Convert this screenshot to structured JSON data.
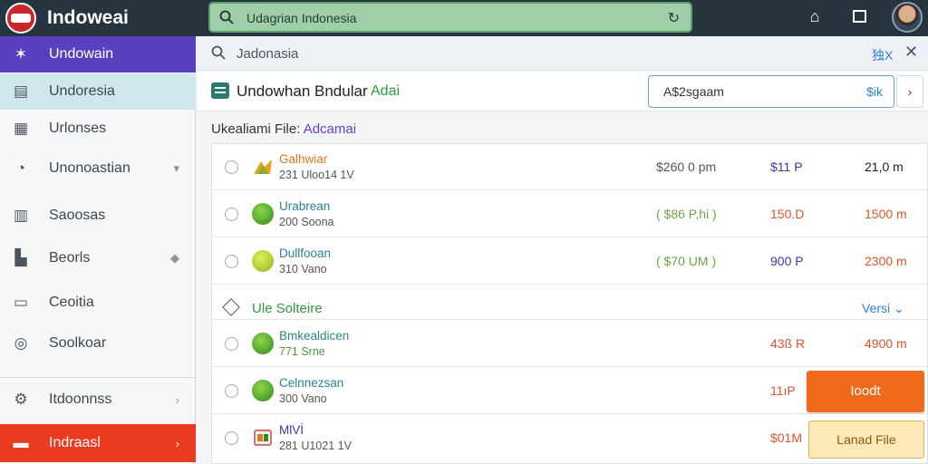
{
  "app": {
    "title": "Indoweai"
  },
  "search": {
    "value": "Udagrian Indonesia"
  },
  "sidebar": {
    "items": [
      {
        "label": "Undowain",
        "icon": "star-icon",
        "state": "active-purple"
      },
      {
        "label": "Undoresia",
        "icon": "grid-icon",
        "state": "active-teal"
      },
      {
        "label": "Urlonses",
        "icon": "calculator-icon",
        "state": ""
      },
      {
        "label": "Unonoastian",
        "icon": "compass-icon",
        "state": "",
        "chevron": "▾"
      },
      {
        "label": "Saoosas",
        "icon": "briefcase-icon",
        "state": ""
      },
      {
        "label": "Beorls",
        "icon": "building-icon",
        "state": "",
        "chevron": "◆"
      },
      {
        "label": "Ceoitia",
        "icon": "window-icon",
        "state": ""
      },
      {
        "label": "Soolkoar",
        "icon": "target-icon",
        "state": ""
      },
      {
        "label": "Itdoonnss",
        "icon": "gear-icon",
        "state": "",
        "chevron": "›"
      },
      {
        "label": "Indraasl",
        "icon": "wallet-icon",
        "state": "active-red",
        "chevron": "›"
      }
    ]
  },
  "crumb": {
    "text": "Jadonasia",
    "right": "独X"
  },
  "header": {
    "title": "Undowhan Bndular",
    "accent": "Adai",
    "amount": "A$2sgaam",
    "amount_unit": "$ik",
    "next": "›"
  },
  "section": {
    "label": "Ukealiami File:",
    "accent": "Adcamai"
  },
  "rows": [
    {
      "name": "Galhwiar",
      "name_color": "#e0761e",
      "sub": "231 Uloo14 1V",
      "c1": "$260 0 pm",
      "c1_color": "#555555",
      "c2": "$11 P",
      "c2_color": "#3a3aa8",
      "c3": "21,0 m",
      "c3_color": "#222222",
      "thumb": "thumb-mixed"
    },
    {
      "name": "Urabrean",
      "name_color": "#2a7f9c",
      "sub": "200 Soona",
      "c1": "( $86 P,hi )",
      "c1_color": "#6aa640",
      "c2": "150.D",
      "c2_color": "#e0522a",
      "c3": "1500 m",
      "c3_color": "#e0522a",
      "thumb": "thumb-green"
    },
    {
      "name": "Dullfooan",
      "name_color": "#2a7f9c",
      "sub": "310 Vano",
      "c1": "( $70 UM )",
      "c1_color": "#6aa640",
      "c2": "900 P",
      "c2_color": "#3a3aa8",
      "c3": "2300 m",
      "c3_color": "#e0522a",
      "thumb": "thumb-lime"
    },
    {
      "group": true,
      "label": "Ule Solteire",
      "right": "Versi ⌄"
    },
    {
      "name": "Bmkealdicen",
      "name_color": "#2a8a86",
      "sub": "771 Srne",
      "c1": "",
      "c2": "43ß R",
      "c2_color": "#e0522a",
      "c3": "4900 m",
      "c3_color": "#e0522a",
      "thumb": "thumb-green",
      "sub_color": "#4c9b3a"
    },
    {
      "name": "Celnnezsan",
      "name_color": "#2a7f9c",
      "sub": "300 Vano",
      "c1": "",
      "c2": "11ıP",
      "c2_color": "#e0522a",
      "c3": "",
      "thumb": "thumb-green"
    },
    {
      "name": "MlVİ",
      "name_color": "#3a3aa8",
      "sub": "281 U1021 1V",
      "c1": "",
      "c2": "$01M",
      "c2_color": "#e0522a",
      "c3": "",
      "thumb": "thumb-mixed"
    }
  ],
  "buttons": {
    "primary": "Ioodt",
    "secondary": "Lanad File"
  },
  "colors": {
    "topbar": "#26343f",
    "active_purple": "#5a3fc0",
    "active_red": "#ea3b22",
    "search_bg": "#9fcfa9",
    "orange": "#f06a1c"
  }
}
